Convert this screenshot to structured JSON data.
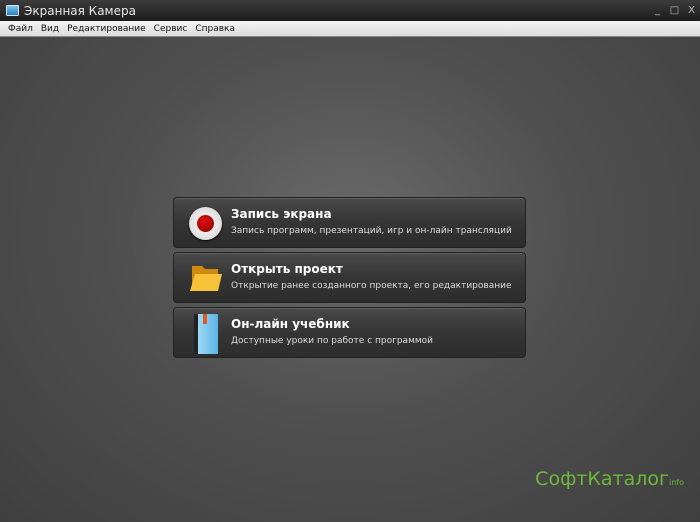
{
  "window": {
    "title": "Экранная Камера",
    "controls": [
      "_",
      "□",
      "X"
    ]
  },
  "menu": [
    "Файл",
    "Вид",
    "Редактирование",
    "Сервис",
    "Справка"
  ],
  "cards": [
    {
      "title": "Запись экрана",
      "subtitle": "Запись программ, презентаций, игр и он-лайн трансляций",
      "icon": "record-icon"
    },
    {
      "title": "Открыть проект",
      "subtitle": "Открытие ранее созданного проекта, его редактирование",
      "icon": "folder-icon"
    },
    {
      "title": "Он-лайн учебник",
      "subtitle": "Доступные уроки по работе с программой",
      "icon": "book-icon"
    }
  ],
  "watermark": {
    "main": "СофтКаталог",
    "suffix": "info"
  }
}
